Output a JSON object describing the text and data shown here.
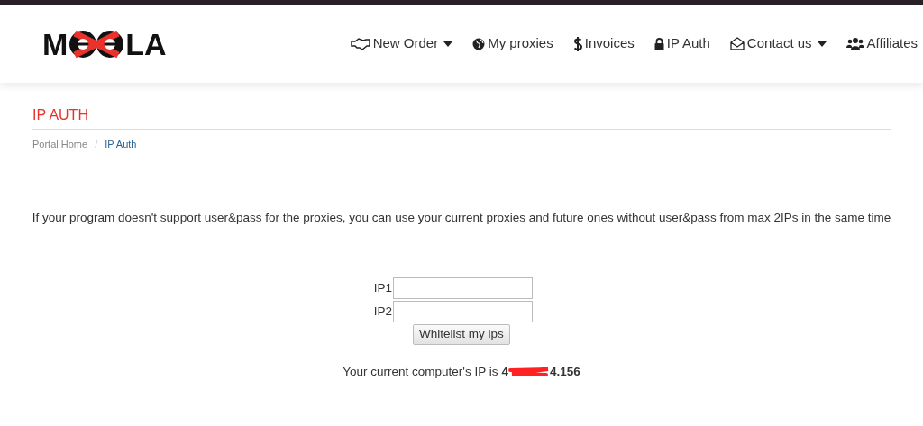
{
  "logo": {
    "left": "M",
    "right": "LA"
  },
  "nav": [
    {
      "label": "New Order",
      "dropdown": true
    },
    {
      "label": "My proxies",
      "dropdown": false
    },
    {
      "label": "Invoices",
      "dropdown": false
    },
    {
      "label": "IP Auth",
      "dropdown": false
    },
    {
      "label": "Contact us",
      "dropdown": true
    },
    {
      "label": "Affiliates",
      "dropdown": false
    }
  ],
  "page_title": "IP AUTH",
  "breadcrumb": [
    {
      "label": "Portal Home",
      "selected": false
    },
    {
      "label": "IP Auth",
      "selected": true
    }
  ],
  "breadcrumb_separator": "/",
  "intro": "If your program doesn't support user&pass for the proxies, you can use your current proxies and future ones without user&pass from max 2IPs in the same time",
  "fields": [
    {
      "label": "IP1"
    },
    {
      "label": "IP2"
    }
  ],
  "submit_button": "Whitelist my ips",
  "current_ip": {
    "label": "Your current computer's IP is",
    "prefix": "4",
    "suffix": "4.156"
  }
}
